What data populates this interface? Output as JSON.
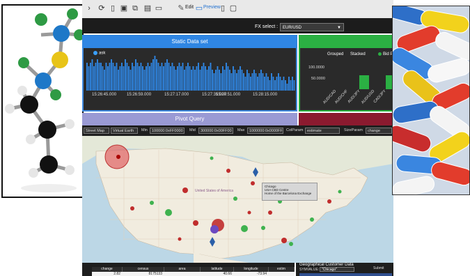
{
  "toolbar": {
    "icons": [
      "refresh-icon",
      "new-document-icon",
      "save-icon",
      "export-icon",
      "grid-icon",
      "pdf-icon"
    ],
    "edit_label": "Edit",
    "preview_label": "Preview"
  },
  "fx": {
    "label": "FX select :",
    "value": "EUR/USD"
  },
  "static_panel": {
    "title": "Static Data set",
    "legend": "ask",
    "ticks": [
      "15:26:45.000",
      "15:26:59.000",
      "15:27:17.000",
      "15:27:35.000",
      "15:27:51.000",
      "15:28:15.000"
    ]
  },
  "chart_data": [
    {
      "type": "bar",
      "title": "Static Data set",
      "series": [
        {
          "name": "ask",
          "values": [
            8,
            7,
            8,
            9,
            7,
            8,
            9,
            8,
            8,
            7,
            6,
            8,
            7,
            8,
            9,
            8,
            7,
            8,
            6,
            7,
            8,
            7,
            9,
            8,
            7,
            6,
            8,
            7,
            9,
            8,
            7,
            8,
            7,
            6,
            7,
            8,
            7,
            8,
            9,
            10,
            9,
            8,
            7,
            8,
            7,
            8,
            9,
            8,
            7,
            8,
            7,
            6,
            7,
            8,
            7,
            8,
            6,
            7,
            8,
            7,
            6,
            7,
            6,
            7,
            8,
            6,
            7,
            8,
            7,
            6,
            7,
            8,
            6,
            5,
            6,
            7,
            6,
            5,
            7,
            6,
            8,
            7,
            6,
            5,
            7,
            6,
            5,
            6,
            7,
            6,
            5,
            4,
            6,
            5,
            4,
            5,
            6,
            5,
            4,
            5,
            6,
            5,
            4,
            5,
            4,
            3,
            5,
            4,
            3,
            4,
            5,
            4,
            3,
            4,
            3,
            2,
            4,
            3,
            4,
            3
          ]
        }
      ],
      "xlabel": "",
      "ylabel": ""
    },
    {
      "type": "bar",
      "categories": [
        "AUD/CAD",
        "AUD/CHF",
        "AUD/JPY",
        "AUD/USD",
        "CAD/JPY"
      ],
      "series": [
        {
          "name": "Bid",
          "values": [
            0,
            0,
            50000,
            0,
            50000
          ]
        }
      ],
      "yticks": [
        "100.0000",
        "50.0000"
      ],
      "ylim": [
        0,
        100000
      ],
      "xlabel": "",
      "ylabel": ""
    }
  ],
  "group_panel": {
    "grouped_label": "Grouped",
    "stacked_label": "Stacked",
    "legend": "Bid P",
    "yticks": [
      "100.0000",
      "50.0000"
    ],
    "categories": [
      "AUD/CAD",
      "AUD/CHF",
      "AUD/JPY",
      "AUD/USD",
      "CAD/JPY"
    ]
  },
  "pivot": {
    "title": "Pivot Query"
  },
  "mapbar": {
    "street_map": "Street Map",
    "virtual_earth": "Virtual Earth",
    "min_label": "Min",
    "min_value": "100000:0xFF0000",
    "mid_label": "Mid",
    "mid_value": "300000:0x00FF00",
    "max_label": "Max",
    "max_value": "1000000:0x0000FF",
    "colparam_label": "ColParam",
    "colparam_value": "estimate",
    "sizeparam_label": "SizeParam",
    "sizeparam_value": "change"
  },
  "map": {
    "popup_title": "Chicago",
    "popup_line1": "USA CBD Centre",
    "popup_line2": "Home of the Barcelona Exchange",
    "country_label": "United States of America"
  },
  "grid": {
    "headers": [
      "change",
      "census",
      "area",
      "latitude",
      "longitude",
      "estim"
    ],
    "row": [
      "2.82",
      "8175133",
      "",
      "40.66",
      "-73.94",
      ""
    ]
  },
  "geo": {
    "title": "Geographical Customer Data",
    "sym_label": "SYMVALUE:",
    "sym_value": "\"Chicago\"",
    "submit": "Submit"
  }
}
